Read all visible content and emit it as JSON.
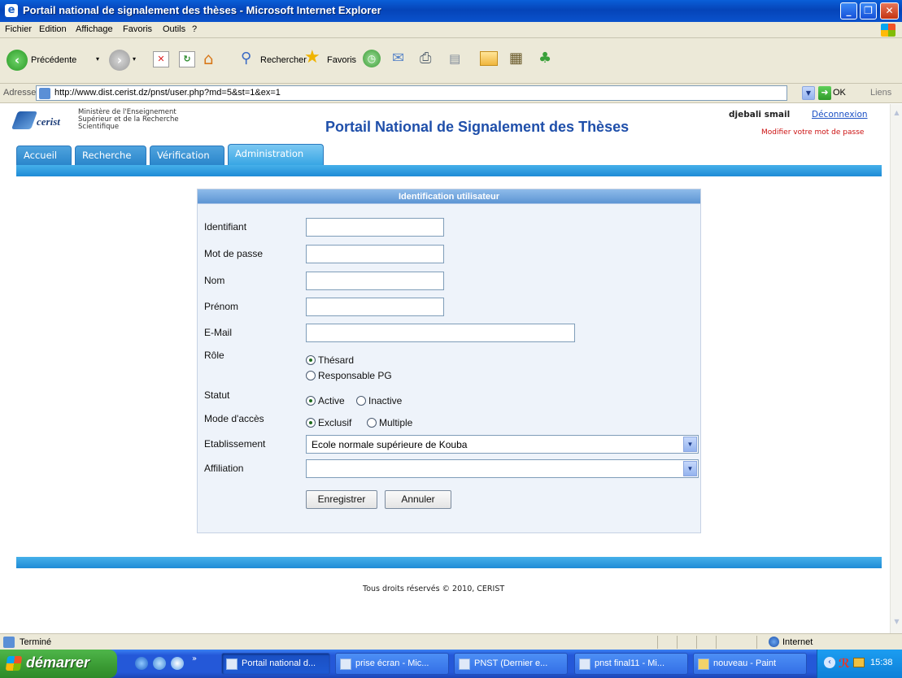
{
  "window": {
    "title": "Portail national de signalement des thèses - Microsoft Internet Explorer",
    "minimize": "_",
    "maximize": "❐",
    "close": "✕"
  },
  "menu": [
    "Fichier",
    "Edition",
    "Affichage",
    "Favoris",
    "Outils",
    "?"
  ],
  "toolbar": {
    "back_label": "Précédente",
    "search_label": "Rechercher",
    "favorites_label": "Favoris"
  },
  "address": {
    "label": "Adresse",
    "url": "http://www.dist.cerist.dz/pnst/user.php?md=5&st=1&ex=1",
    "go_label": "OK",
    "links_label": "Liens"
  },
  "site": {
    "logo_text": "cerist",
    "ministry_line1": "Ministère de l'Enseignement",
    "ministry_line2": "Supérieur et de la Recherche",
    "ministry_line3": "Scientifique",
    "title": "Portail National de Signalement des Thèses",
    "user_name": "djebali smail",
    "logout_label": "Déconnexion",
    "change_password_label": "Modifier votre mot de passe"
  },
  "nav": {
    "tabs": [
      "Accueil",
      "Recherche",
      "Vérification",
      "Administration"
    ],
    "active": "Administration"
  },
  "form": {
    "heading": "Identification utilisateur",
    "fields": {
      "identifiant": {
        "label": "Identifiant",
        "value": ""
      },
      "password": {
        "label": "Mot de passe",
        "value": ""
      },
      "nom": {
        "label": "Nom",
        "value": ""
      },
      "prenom": {
        "label": "Prénom",
        "value": ""
      },
      "email": {
        "label": "E-Mail",
        "value": ""
      }
    },
    "role": {
      "label": "Rôle",
      "options": [
        "Thésard",
        "Responsable PG"
      ],
      "selected": "Thésard"
    },
    "statut": {
      "label": "Statut",
      "options": [
        "Active",
        "Inactive"
      ],
      "selected": "Active"
    },
    "mode": {
      "label": "Mode d'accès",
      "options": [
        "Exclusif",
        "Multiple"
      ],
      "selected": "Exclusif"
    },
    "etablissement": {
      "label": "Etablissement",
      "value": "Ecole normale supérieure de Kouba"
    },
    "affiliation": {
      "label": "Affiliation",
      "value": ""
    },
    "save_label": "Enregistrer",
    "cancel_label": "Annuler"
  },
  "footer": {
    "copyright": "Tous droits réservés © 2010, CERIST"
  },
  "status": {
    "left": "Terminé",
    "zone": "Internet"
  },
  "taskbar": {
    "start_label": "démarrer",
    "tasks": [
      "Portail national d...",
      "prise écran - Mic...",
      "PNST (Dernier e...",
      "pnst final11 - Mi...",
      "nouveau - Paint"
    ],
    "active_task": 0,
    "clock": "15:38"
  }
}
